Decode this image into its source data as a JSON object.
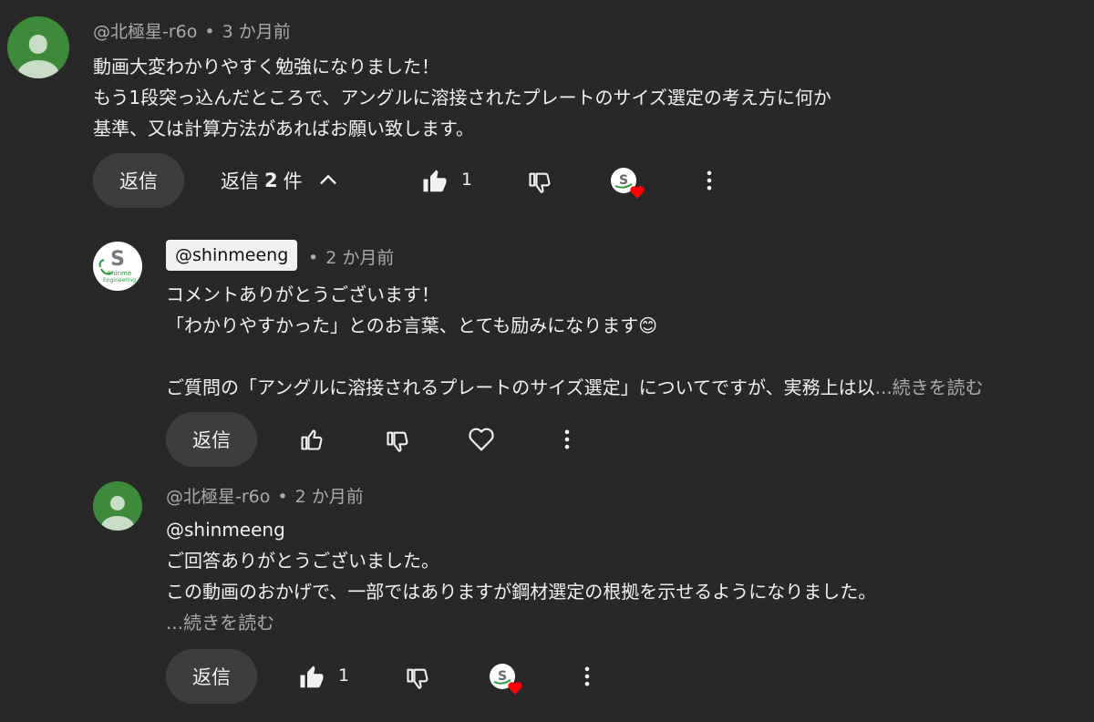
{
  "comment1": {
    "author": "@北極星-r6o",
    "separator": "•",
    "time": "3 か月前",
    "lines": [
      "動画大変わかりやすく勉強になりました！",
      "もう1段突っ込んだところで、アングルに溶接されたプレートのサイズ選定の考え方に何か",
      "基準、又は計算方法があればお願い致します。"
    ],
    "reply_label": "返信",
    "replies_toggle": {
      "prefix": "返信",
      "count": "2",
      "suffix": "件"
    },
    "like_count": "1"
  },
  "reply1": {
    "author": "@shinmeeng",
    "separator": "•",
    "time": "2 か月前",
    "lines": [
      "コメントありがとうございます！",
      "「わかりやすかった」とのお言葉、とても励みになります😊",
      "",
      "ご質問の「アングルに溶接されるプレートのサイズ選定」についてですが、実務上は以"
    ],
    "read_more": "...続きを読む",
    "reply_label": "返信"
  },
  "reply2": {
    "author": "@北極星-r6o",
    "separator": "•",
    "time": "2 か月前",
    "lines": [
      "@shinmeeng",
      "ご回答ありがとうございました。",
      "この動画のおかげで、一部ではありますが鋼材選定の根拠を示せるようになりました。"
    ],
    "read_more": "...続きを読む",
    "reply_label": "返信",
    "like_count": "1"
  },
  "logo_text": {
    "letter": "S",
    "line1": "Shinme",
    "line2": "Engineering"
  },
  "colors": {
    "background": "#282828",
    "button": "#3d3d3d",
    "text": "#f1f1f1",
    "muted": "#aaaaaa",
    "heart": "#ff0000",
    "avatar_green": "#3d8a3a",
    "logo_green": "#2e9a3e"
  }
}
